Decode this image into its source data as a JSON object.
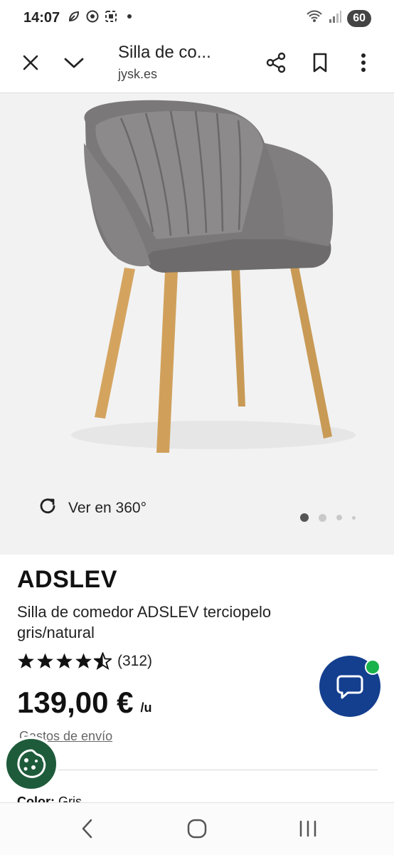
{
  "status_bar": {
    "time": "14:07",
    "battery": "60",
    "icons": [
      "leaf-icon",
      "chrome-icon",
      "screenshot-icon",
      "dot-icon",
      "wifi-icon",
      "signal-icon"
    ]
  },
  "browser": {
    "page_title": "Silla de co...",
    "domain": "jysk.es",
    "close_icon": "close-icon",
    "collapse_icon": "chevron-down-icon",
    "share_icon": "share-icon",
    "bookmark_icon": "bookmark-icon",
    "menu_icon": "more-vert-icon"
  },
  "gallery": {
    "view360_label": "Ver en 360°",
    "dots": 4,
    "active_dot": 0
  },
  "product": {
    "brand": "ADSLEV",
    "description": "Silla de comedor ADSLEV terciopelo gris/natural",
    "rating_value": 4.5,
    "rating_count": "(312)",
    "price": "139,00 €",
    "unit": "/u",
    "shipping_link": "Gastos de envío",
    "color_label": "Color:",
    "color_value": "Gris"
  },
  "colors": {
    "chat_fab": "#143f8f",
    "chat_badge": "#19b24a",
    "cookie_fab": "#1e5b3b",
    "hero_bg": "#f2f2f2"
  },
  "nav": {
    "back_icon": "back-icon",
    "home_icon": "home-icon",
    "recents_icon": "recents-icon"
  }
}
